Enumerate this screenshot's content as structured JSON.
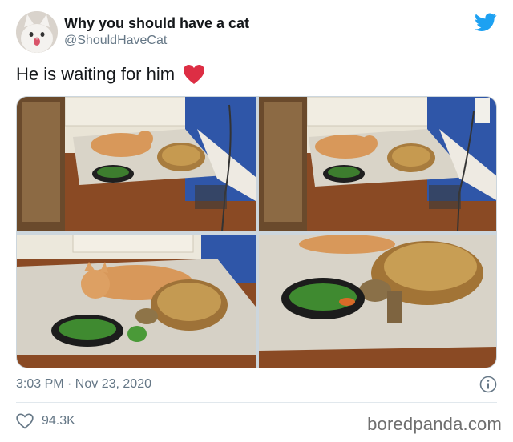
{
  "tweet": {
    "display_name": "Why you should have a cat",
    "handle": "@ShouldHaveCat",
    "text": "He is waiting for him",
    "timestamp": "3:03 PM · Nov 23, 2020",
    "like_count": "94.3K"
  },
  "icons": {
    "platform": "twitter-bird-icon",
    "emoji": "red-heart-icon",
    "info": "info-icon",
    "like": "heart-outline-icon"
  },
  "colors": {
    "twitter_blue": "#1da1f2",
    "heart_red": "#e0245e",
    "secondary_text": "#657786",
    "primary_text": "#14171a"
  },
  "watermark": "boredpanda.com"
}
